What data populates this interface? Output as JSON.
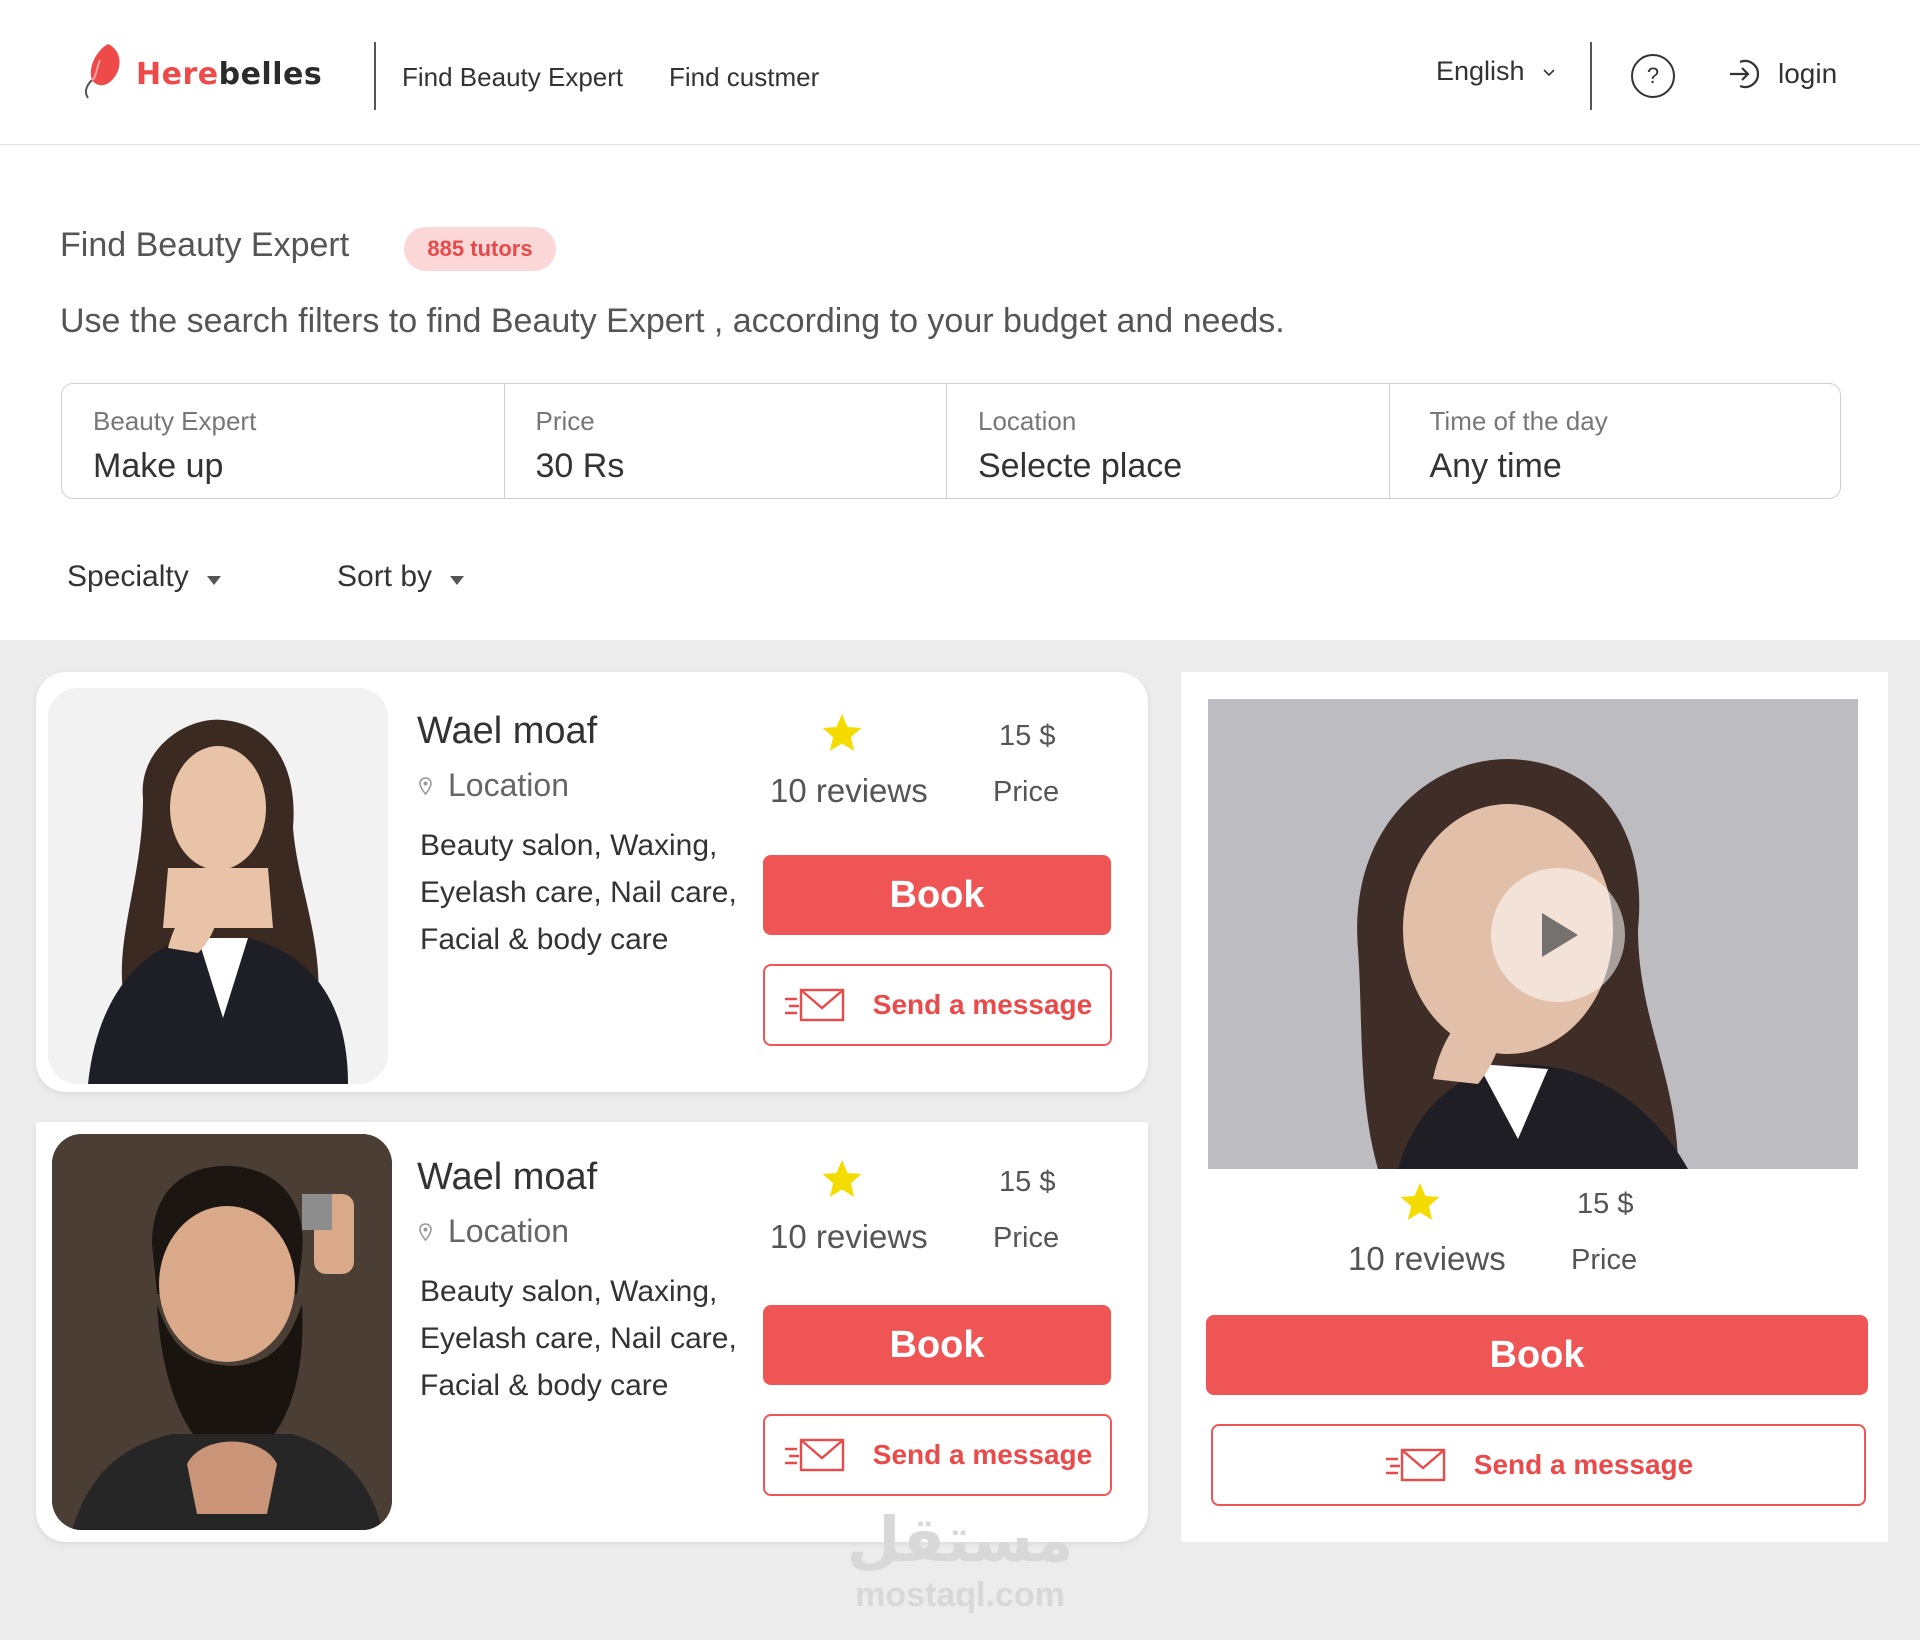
{
  "brand": {
    "part1": "Here",
    "part2": "belles"
  },
  "nav": {
    "find_expert": "Find Beauty Expert",
    "find_customer": "Find custmer"
  },
  "header": {
    "language": "English",
    "help": "?",
    "login": "login"
  },
  "page": {
    "title": "Find Beauty Expert",
    "badge": "885 tutors",
    "subtitle": "Use the search filters to find Beauty Expert , according to your budget and needs."
  },
  "filters": [
    {
      "label": "Beauty Expert",
      "value": "Make up"
    },
    {
      "label": "Price",
      "value": "30 Rs"
    },
    {
      "label": "Location",
      "value": "Selecte place"
    },
    {
      "label": "Time of the day",
      "value": "Any time"
    }
  ],
  "dropdowns": {
    "specialty": "Specialty",
    "sort": "Sort by"
  },
  "experts": [
    {
      "name": "Wael moaf",
      "location": "Location",
      "specialties": "Beauty salon, Waxing, Eyelash care, Nail care, Facial & body care",
      "reviews": "10 reviews",
      "price": "15 $",
      "price_label": "Price",
      "book": "Book",
      "message": "Send a message"
    },
    {
      "name": "Wael moaf",
      "location": "Location",
      "specialties": "Beauty salon, Waxing, Eyelash care, Nail care, Facial & body care",
      "reviews": "10 reviews",
      "price": "15 $",
      "price_label": "Price",
      "book": "Book",
      "message": "Send a message"
    }
  ],
  "featured": {
    "reviews": "10 reviews",
    "price": "15 $",
    "price_label": "Price",
    "book": "Book",
    "message": "Send a message"
  },
  "watermark": {
    "arabic": "مستقل",
    "latin": "mostaql.com"
  },
  "colors": {
    "accent": "#f05555",
    "badge_bg": "#fbd7d7",
    "star": "#f5dc00",
    "panel_bg": "#ececec"
  }
}
